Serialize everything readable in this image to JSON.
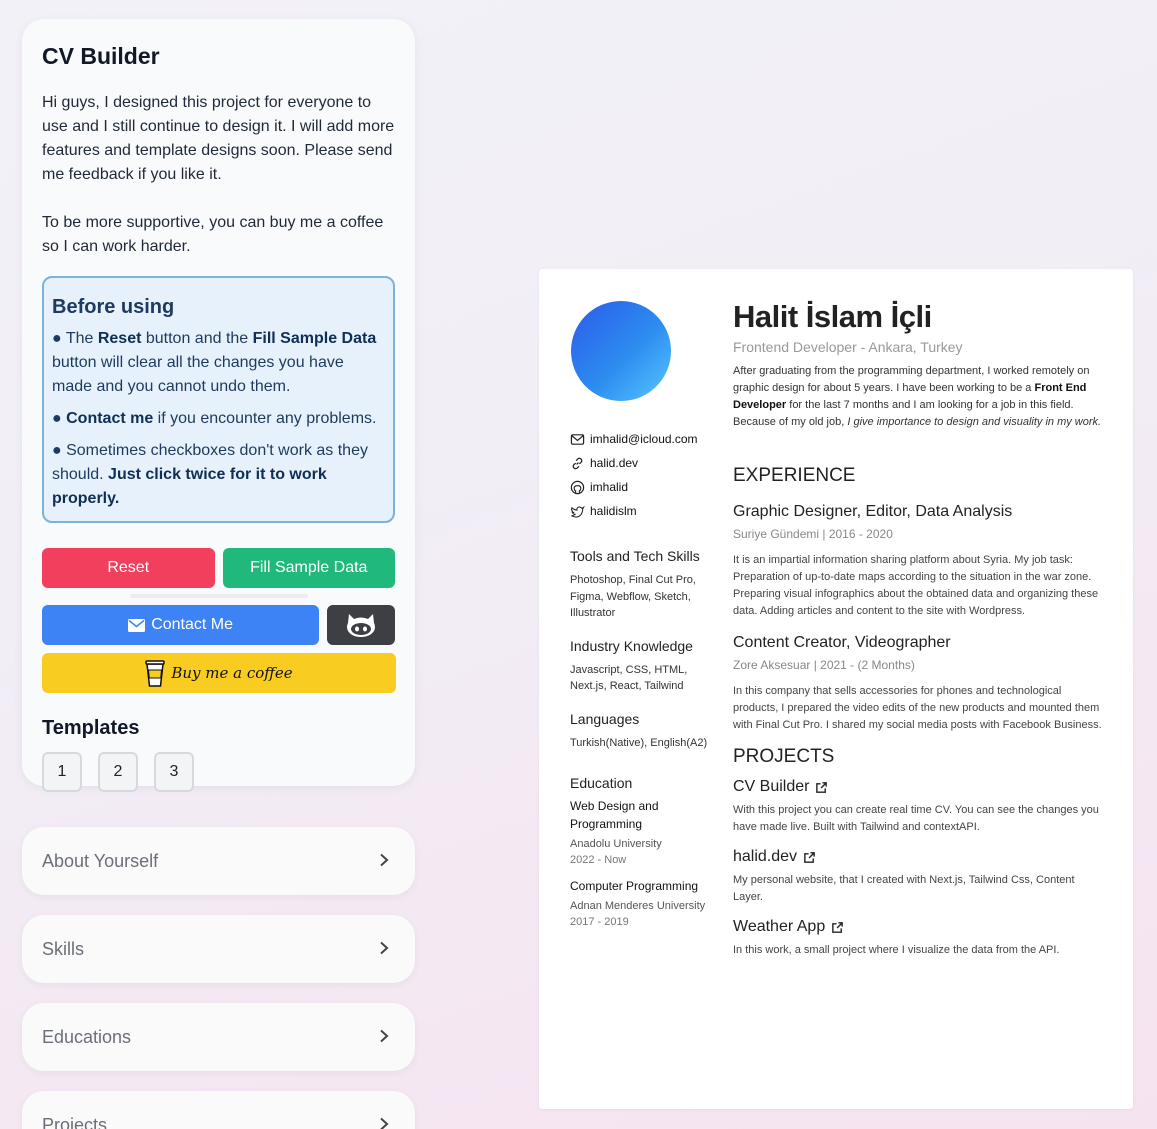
{
  "sidebar": {
    "title": "CV Builder",
    "intro_p1": "Hi guys, I designed this project for everyone to use and I still continue to design it. I will add more features and template designs soon. Please send me feedback if you like it.",
    "intro_p2": "To be more supportive, you can buy me a coffee so I can work harder.",
    "before_using": {
      "title": "Before using",
      "b1_pre": "The ",
      "b1_reset": "Reset",
      "b1_mid": " button and the ",
      "b1_fill": "Fill Sample Data",
      "b1_post": " button will clear all the changes you have made and you cannot undo them.",
      "b2_bold": "Contact me",
      "b2_post": " if you encounter any problems.",
      "b3_pre": "Sometimes checkboxes don't work as they should. ",
      "b3_bold": "Just click twice for it to work properly."
    },
    "buttons": {
      "reset": "Reset",
      "fill": "Fill Sample Data",
      "contact": "Contact Me",
      "coffee": "Buy me a coffee"
    },
    "templates_title": "Templates",
    "templates": [
      "1",
      "2",
      "3"
    ],
    "colors": {
      "reset": "#f23f5e",
      "fill": "#21b87b",
      "contact": "#3e83f5",
      "github": "#3d3f45",
      "coffee": "#f9cc22"
    }
  },
  "accordions": [
    "About Yourself",
    "Skills",
    "Educations",
    "Projects"
  ],
  "cv": {
    "name": "Halit İslam İçli",
    "role": "Frontend Developer - Ankara, Turkey",
    "about_1": "After graduating from the programming department, I worked remotely on graphic design for about 5 years. I have been working to be a ",
    "about_bold": "Front End Developer",
    "about_2": " for the last 7 months and I am looking for a job in this field. Because of my old job, ",
    "about_italic": "I give importance to design and visuality in my work.",
    "contacts": {
      "email": "imhalid@icloud.com",
      "website": "halid.dev",
      "github": "imhalid",
      "twitter": "halidislm"
    },
    "skills": [
      {
        "title": "Tools and Tech Skills",
        "text": "Photoshop, Final Cut Pro, Figma, Webflow, Sketch, Illustrator"
      },
      {
        "title": "Industry Knowledge",
        "text": "Javascript, CSS, HTML, Next.js, React, Tailwind"
      },
      {
        "title": "Languages",
        "text": "Turkish(Native), English(A2)"
      }
    ],
    "education_title": "Education",
    "education": [
      {
        "school": "Web Design and Programming",
        "uni": "Anadolu University",
        "date": "2022 - Now"
      },
      {
        "school": "Computer Programming",
        "uni": "Adnan Menderes University",
        "date": "2017 - 2019"
      }
    ],
    "experience_title": "EXPERIENCE",
    "experience": [
      {
        "title": "Graphic Designer, Editor, Data Analysis",
        "meta": "Suriye Gündemi | 2016 - 2020",
        "desc": "It is an impartial information sharing platform about Syria. My job task: Preparation of up-to-date maps according to the situation in the war zone. Preparing visual infographics about the obtained data and organizing these data. Adding articles and content to the site with Wordpress."
      },
      {
        "title": "Content Creator, Videographer",
        "meta": "Zore Aksesuar | 2021 - (2 Months)",
        "desc": "In this company that sells accessories for phones and technological products, I prepared the video edits of the new products and mounted them with Final Cut Pro. I shared my social media posts with Facebook Business."
      }
    ],
    "projects_title": "PROJECTS",
    "projects": [
      {
        "title": "CV Builder",
        "desc": "With this project you can create real time CV. You can see the changes you have made live. Built with Tailwind and contextAPI."
      },
      {
        "title": "halid.dev",
        "desc": "My personal website, that I created with Next.js, Tailwind Css, Content Layer."
      },
      {
        "title": "Weather App",
        "desc": "In this work, a small project where I visualize the data from the API."
      }
    ],
    "avatar_gradient": [
      "#2b5bea",
      "#55c8ff"
    ]
  }
}
